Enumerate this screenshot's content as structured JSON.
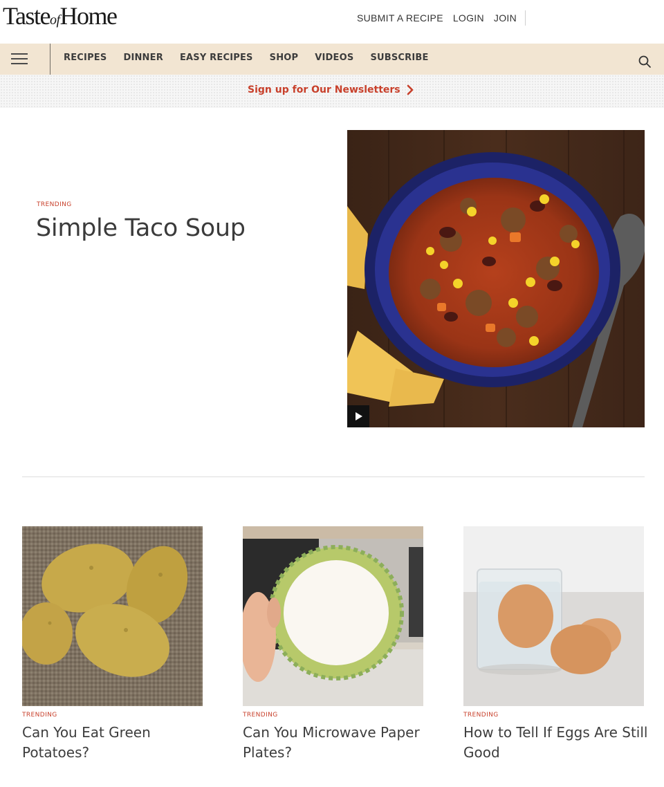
{
  "header": {
    "logo_taste": "Taste",
    "logo_of": "of",
    "logo_home": "Home",
    "links": [
      "SUBMIT A RECIPE",
      "LOGIN",
      "JOIN"
    ]
  },
  "nav": {
    "items": [
      "RECIPES",
      "DINNER",
      "EASY RECIPES",
      "SHOP",
      "VIDEOS",
      "SUBSCRIBE"
    ],
    "menu_icon": "hamburger-icon",
    "search_icon": "search-icon"
  },
  "newsletter": {
    "label": "Sign up for Our Newsletters",
    "arrow_icon": "chevron-right-icon"
  },
  "hero": {
    "kicker": "TRENDING",
    "title": "Simple Taco Soup",
    "play_icon": "play-icon"
  },
  "cards": [
    {
      "kicker": "TRENDING",
      "title": "Can You Eat Green Potatoes?"
    },
    {
      "kicker": "TRENDING",
      "title": "Can You Microwave Paper Plates?"
    },
    {
      "kicker": "TRENDING",
      "title": "How to Tell If Eggs Are Still Good"
    }
  ],
  "colors": {
    "accent": "#c8402b",
    "nav_bg": "#f2e5d2",
    "text": "#3a3a3a"
  }
}
